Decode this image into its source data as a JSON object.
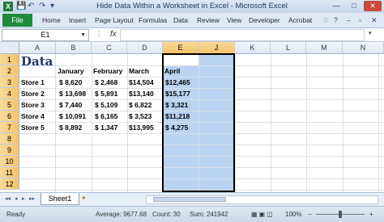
{
  "window": {
    "title": "Hide Data Within a Worksheet in Excel - Microsoft Excel",
    "app_icon_letter": "X",
    "qat": [
      "💾",
      "↶",
      "↷",
      "▾"
    ],
    "controls": {
      "minimize": "—",
      "maximize": "□",
      "close": "✕"
    }
  },
  "ribbon": {
    "file_tab": "File",
    "tabs": [
      "Home",
      "Insert",
      "Page Layout",
      "Formulas",
      "Data",
      "Review",
      "View",
      "Developer",
      "Acrobat"
    ],
    "right_icons": [
      "♢",
      "?",
      "–",
      "▫",
      "✕"
    ]
  },
  "formula_bar": {
    "name_box": "E1",
    "fx_label": "fx",
    "formula": ""
  },
  "columns": [
    "A",
    "B",
    "C",
    "D",
    "E",
    "J",
    "K",
    "L",
    "M",
    "N"
  ],
  "selected_columns": [
    "E",
    "J"
  ],
  "rows": [
    "1",
    "2",
    "3",
    "4",
    "5",
    "6",
    "7",
    "8",
    "9",
    "10",
    "11",
    "12"
  ],
  "selected_rows": [
    "1",
    "2",
    "3",
    "4",
    "5",
    "6",
    "7",
    "8",
    "9",
    "10",
    "11",
    "12"
  ],
  "sheet": {
    "title": "Data",
    "headers": [
      "January",
      "February",
      "March"
    ],
    "header_e": "April",
    "stores": [
      "Store 1",
      "Store 2",
      "Store 3",
      "Store 4",
      "Store 5"
    ],
    "jan": [
      "$  8,620",
      "$ 13,698",
      "$  7,440",
      "$ 10,091",
      "$  8,892"
    ],
    "feb": [
      "$  2,468",
      "$  5,891",
      "$  5,109",
      "$  6,165",
      "$  1,347"
    ],
    "mar": [
      "$14,504",
      "$13,140",
      "$  6,822",
      "$  3,523",
      "$13,995"
    ],
    "apr": [
      "$12,465",
      "$15,177",
      "$  3,321",
      "$11,218",
      "$  4,275"
    ]
  },
  "sheet_tabs": {
    "nav": [
      "◂◂",
      "◂",
      "▸",
      "▸▸"
    ],
    "active": "Sheet1",
    "new_sheet_icon": "✦"
  },
  "status_bar": {
    "mode": "Ready",
    "average": "Average: 9677.68",
    "count": "Count: 30",
    "sum": "Sum: 241942",
    "zoom": "100%",
    "minus": "−",
    "plus": "+"
  }
}
